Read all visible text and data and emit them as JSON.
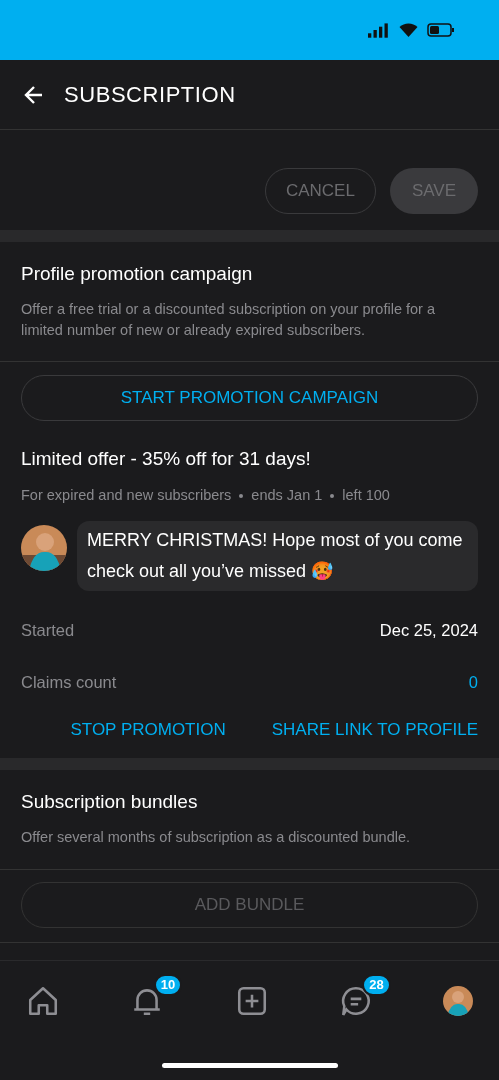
{
  "header": {
    "title": "SUBSCRIPTION"
  },
  "actions": [
    {
      "label": "CANCEL",
      "kind": "outline",
      "disabled": true
    },
    {
      "label": "SAVE",
      "kind": "filled",
      "disabled": true
    }
  ],
  "promotion": {
    "title": "Profile promotion campaign",
    "description": "Offer a free trial or a discounted subscription on your profile for a limited number of new or already expired subscribers.",
    "button": "START PROMOTION CAMPAIGN"
  },
  "offer": {
    "title": "Limited offer - 35% off for 31 days!",
    "meta": [
      "For expired and new subscribers",
      "ends Jan 1",
      "left 100"
    ],
    "message": "MERRY CHRISTMAS! Hope most of you come check out all you’ve missed 🥵",
    "details": [
      {
        "label": "Started",
        "value": "Dec 25, 2024",
        "kind": "plain"
      },
      {
        "label": "Claims count",
        "value": "0",
        "kind": "link"
      }
    ],
    "links": [
      "STOP PROMOTION",
      "SHARE LINK TO PROFILE"
    ]
  },
  "bundles": {
    "title": "Subscription bundles",
    "description": "Offer several months of subscription as a discounted bundle.",
    "button": "ADD BUNDLE",
    "disabled": true
  },
  "nav": [
    {
      "kind": "home"
    },
    {
      "kind": "bell",
      "badge": "10"
    },
    {
      "kind": "plus"
    },
    {
      "kind": "chat",
      "badge": "28"
    },
    {
      "kind": "avatar"
    }
  ]
}
